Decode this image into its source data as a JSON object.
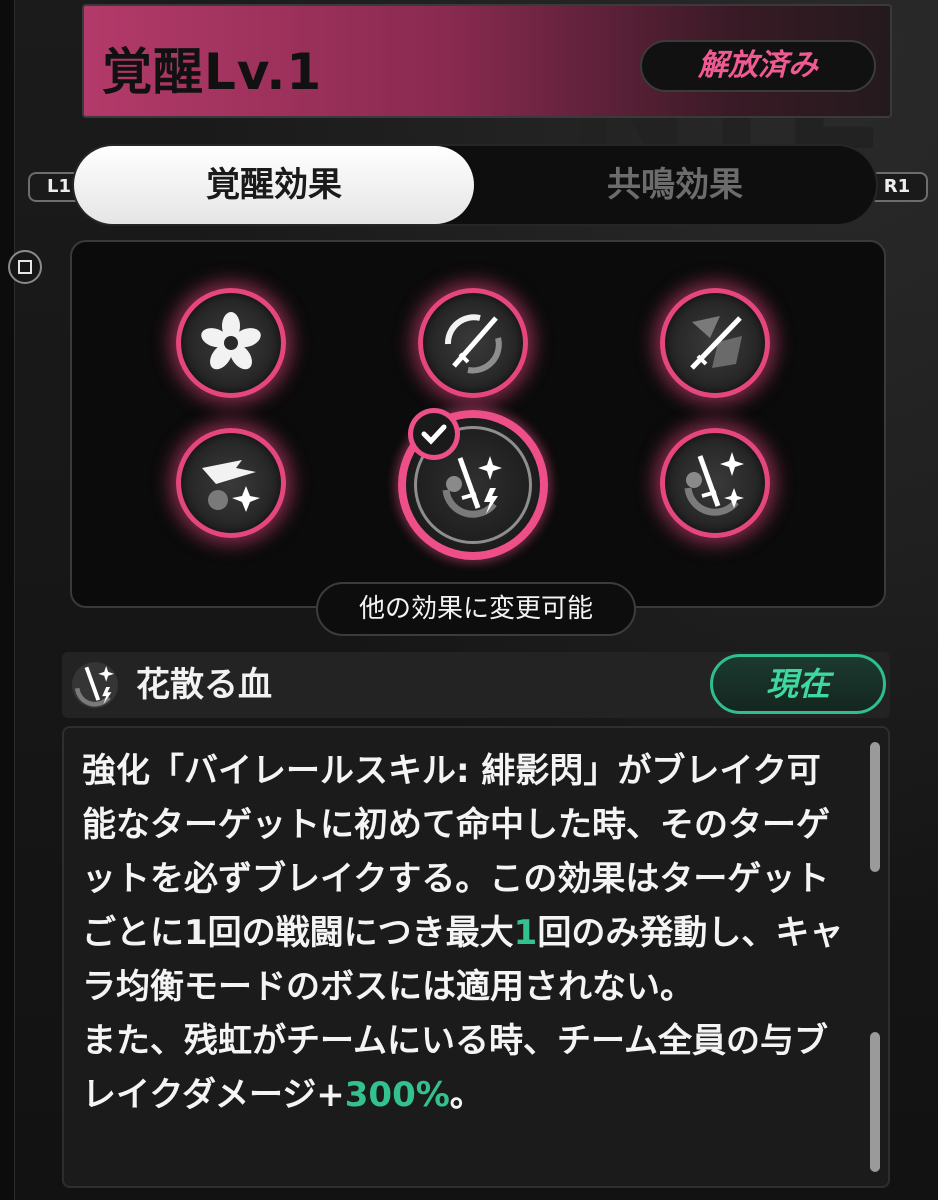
{
  "header": {
    "title": "覚醒Lv.1",
    "status": "解放済み",
    "accent_color": "#b33a6a"
  },
  "controls": {
    "left_shoulder": "L1",
    "right_shoulder": "R1",
    "square_button_icon": "square-button-icon"
  },
  "tabs": [
    {
      "label": "覚醒効果",
      "active": true
    },
    {
      "label": "共鳴効果",
      "active": false
    }
  ],
  "effect_grid": {
    "nodes": [
      {
        "icon": "flower-icon",
        "selected": false
      },
      {
        "icon": "sword-slash-icon",
        "selected": false
      },
      {
        "icon": "sword-shatter-icon",
        "selected": false
      },
      {
        "icon": "dash-sparkle-icon",
        "selected": false
      },
      {
        "icon": "sword-bolt-icon",
        "selected": true
      },
      {
        "icon": "sword-sparkle-icon",
        "selected": false
      }
    ],
    "ring_color": "#e5467e",
    "change_hint": "他の効果に変更可能"
  },
  "effect": {
    "name": "花散る血",
    "icon": "sword-bolt-icon",
    "current_label": "現在",
    "current_color": "#2fbf8c"
  },
  "description": {
    "part1": "強化「バイレールスキル: 緋影閃」がブレイク可能なターゲットに初めて命中した時、そのターゲットを必ずブレイクする。この効果はターゲットごとに1回の戦闘につき最大",
    "value1": "1",
    "part2": "回のみ発動し、キャラ均衡モードのボスには適用されない。",
    "part3": "また、残虹がチームにいる時、チーム全員の与ブレイクダメージ+",
    "value2": "300%",
    "part4": "。",
    "highlight_color": "#33c28e"
  }
}
